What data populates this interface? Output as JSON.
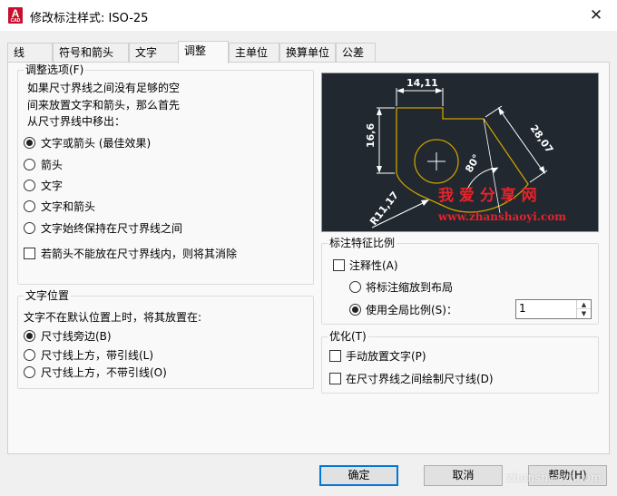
{
  "window": {
    "title": "修改标注样式: ISO-25",
    "app_icon_letter": "A",
    "app_icon_sub": "CAD",
    "close_glyph": "✕"
  },
  "tabs": [
    {
      "label": "线",
      "active": false
    },
    {
      "label": "符号和箭头",
      "active": false
    },
    {
      "label": "文字",
      "active": false
    },
    {
      "label": "调整",
      "active": true
    },
    {
      "label": "主单位",
      "active": false
    },
    {
      "label": "换算单位",
      "active": false
    },
    {
      "label": "公差",
      "active": false
    }
  ],
  "fit_options": {
    "legend": "调整选项(F)",
    "description": [
      "如果尺寸界线之间没有足够的空",
      "间来放置文字和箭头，那么首先",
      "从尺寸界线中移出："
    ],
    "radios": [
      {
        "label": "文字或箭头 (最佳效果)",
        "checked": true
      },
      {
        "label": "箭头",
        "checked": false
      },
      {
        "label": "文字",
        "checked": false
      },
      {
        "label": "文字和箭头",
        "checked": false
      },
      {
        "label": "文字始终保持在尺寸界线之间",
        "checked": false
      }
    ],
    "suppress_checkbox": {
      "label": "若箭头不能放在尺寸界线内，则将其消除",
      "checked": false
    }
  },
  "text_placement": {
    "legend": "文字位置",
    "description": "文字不在默认位置上时，将其放置在:",
    "radios": [
      {
        "label": "尺寸线旁边(B)",
        "checked": true
      },
      {
        "label": "尺寸线上方，带引线(L)",
        "checked": false
      },
      {
        "label": "尺寸线上方，不带引线(O)",
        "checked": false
      }
    ]
  },
  "preview": {
    "dim_top": "14,11",
    "dim_left": "16,6",
    "dim_right": "28,07",
    "dim_angle": "80°",
    "dim_radius": "R11,17",
    "watermark_cn": "我 爱 分 享 网",
    "watermark_url": "www.zhanshaoyi.com",
    "colors": {
      "background": "#212830",
      "lines": "#ffffff",
      "part": "#c8a000",
      "watermark": "#e8232a"
    }
  },
  "scale_features": {
    "legend": "标注特征比例",
    "annotative": {
      "label": "注释性(A)",
      "checked": false
    },
    "radio_layout": {
      "label": "将标注缩放到布局",
      "checked": false
    },
    "radio_global": {
      "label": "使用全局比例(S)：",
      "checked": true
    },
    "global_scale_value": "1",
    "spin_up": "▲",
    "spin_down": "▼"
  },
  "fine_tuning": {
    "legend": "优化(T)",
    "manual_place": {
      "label": "手动放置文字(P)",
      "checked": false
    },
    "draw_between": {
      "label": "在尺寸界线之间绘制尺寸线(D)",
      "checked": false
    }
  },
  "buttons": {
    "ok": "确定",
    "cancel": "取消",
    "help": "帮助(H)"
  },
  "watermark_site": "zhanshaoyi.com"
}
